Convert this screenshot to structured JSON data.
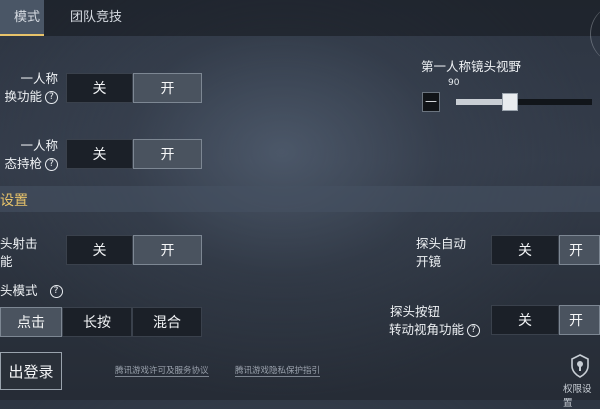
{
  "tabs": [
    {
      "label": "模式"
    },
    {
      "label": "团队竞技"
    }
  ],
  "first_person": {
    "switch": {
      "label_line1": "一人称",
      "label_line2": "换功能",
      "off": "关",
      "on": "开"
    },
    "hold": {
      "label_line1": "一人称",
      "label_line2": "态持枪",
      "off": "关",
      "on": "开"
    },
    "fov": {
      "label": "第一人称镜头视野",
      "value": "90",
      "level": 90,
      "minus": "—"
    }
  },
  "section": {
    "title": "设置"
  },
  "peek": {
    "shoot": {
      "label_line1": "头射击",
      "label_line2": "能",
      "off": "关",
      "on": "开"
    },
    "mode": {
      "label": "头模式",
      "options": [
        "点击",
        "长按",
        "混合"
      ]
    },
    "auto_scope": {
      "label_line1": "探头自动",
      "label_line2": "开镜",
      "off": "关",
      "on": "开"
    },
    "rotate": {
      "label_line1": "探头按钮",
      "label_line2": "转动视角功能",
      "off": "关",
      "on": "开"
    }
  },
  "footer": {
    "logout": "出登录",
    "link1": "腾讯游戏许可及服务协议",
    "link2": "腾讯游戏隐私保护指引",
    "perm": "权限设置"
  },
  "icons": {
    "help": "question-circle-icon",
    "permission": "shield-keyhole-icon"
  },
  "colors": {
    "accent": "#e8c36a",
    "on_button": "#4a535f",
    "off_button": "#1b2028"
  }
}
